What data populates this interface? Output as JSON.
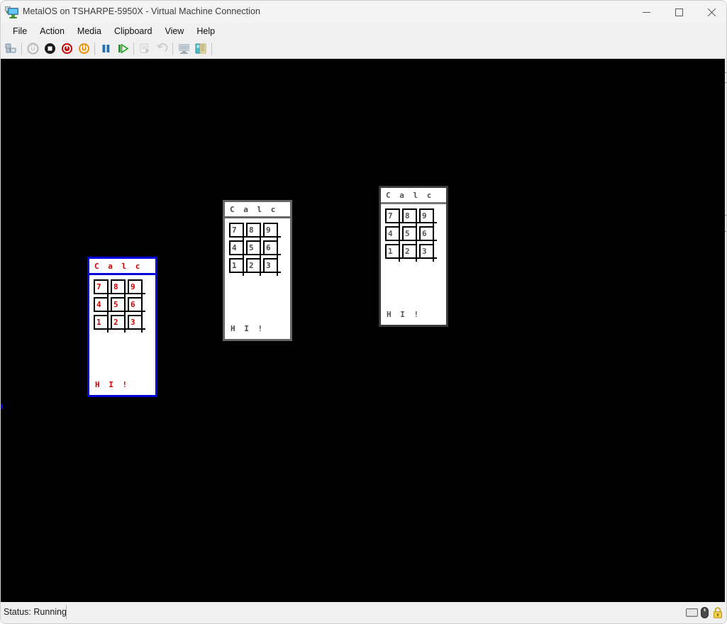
{
  "window": {
    "title": "MetalOS on TSHARPE-5950X - Virtual Machine Connection",
    "app_icon": "virtual-machine-icon",
    "controls": {
      "minimize": "—",
      "maximize": "□",
      "close": "✕"
    }
  },
  "menubar": {
    "items": [
      {
        "label": "File"
      },
      {
        "label": "Action"
      },
      {
        "label": "Media"
      },
      {
        "label": "Clipboard"
      },
      {
        "label": "View"
      },
      {
        "label": "Help"
      }
    ]
  },
  "toolbar": {
    "buttons": [
      {
        "name": "ctrl-alt-del-icon",
        "tooltip": "Ctrl+Alt+Delete"
      },
      {
        "name": "start-icon",
        "tooltip": "Start"
      },
      {
        "name": "turn-off-icon",
        "tooltip": "Turn Off"
      },
      {
        "name": "shut-down-icon",
        "tooltip": "Shut Down"
      },
      {
        "name": "save-state-icon",
        "tooltip": "Save"
      },
      {
        "name": "pause-icon",
        "tooltip": "Pause"
      },
      {
        "name": "reset-icon",
        "tooltip": "Reset"
      },
      {
        "name": "checkpoint-icon",
        "tooltip": "Checkpoint"
      },
      {
        "name": "revert-icon",
        "tooltip": "Revert"
      },
      {
        "name": "enhanced-session-icon",
        "tooltip": "Enhanced Session"
      },
      {
        "name": "share-icon",
        "tooltip": "Share"
      }
    ]
  },
  "vm_screen": {
    "background_color": "#000000",
    "calc_windows": [
      {
        "id": "calc-1",
        "title": "C a l c",
        "message": "H I !",
        "border_color": "#0000e0",
        "text_color": "#d40000",
        "keys": [
          "7",
          "8",
          "9",
          "4",
          "5",
          "6",
          "1",
          "2",
          "3"
        ]
      },
      {
        "id": "calc-2",
        "title": "C a l c",
        "message": "H I !",
        "border_color": "#666666",
        "text_color": "#4a4a4a",
        "keys": [
          "7",
          "8",
          "9",
          "4",
          "5",
          "6",
          "1",
          "2",
          "3"
        ]
      },
      {
        "id": "calc-3",
        "title": "C a l c",
        "message": "H I !",
        "border_color": "#3a3a3a",
        "text_color": "#555555",
        "keys": [
          "7",
          "8",
          "9",
          "4",
          "5",
          "6",
          "1",
          "2",
          "3"
        ]
      }
    ]
  },
  "statusbar": {
    "status": "Status: Running",
    "icons": [
      {
        "name": "keyboard-icon"
      },
      {
        "name": "mouse-icon"
      },
      {
        "name": "lock-icon"
      }
    ]
  }
}
